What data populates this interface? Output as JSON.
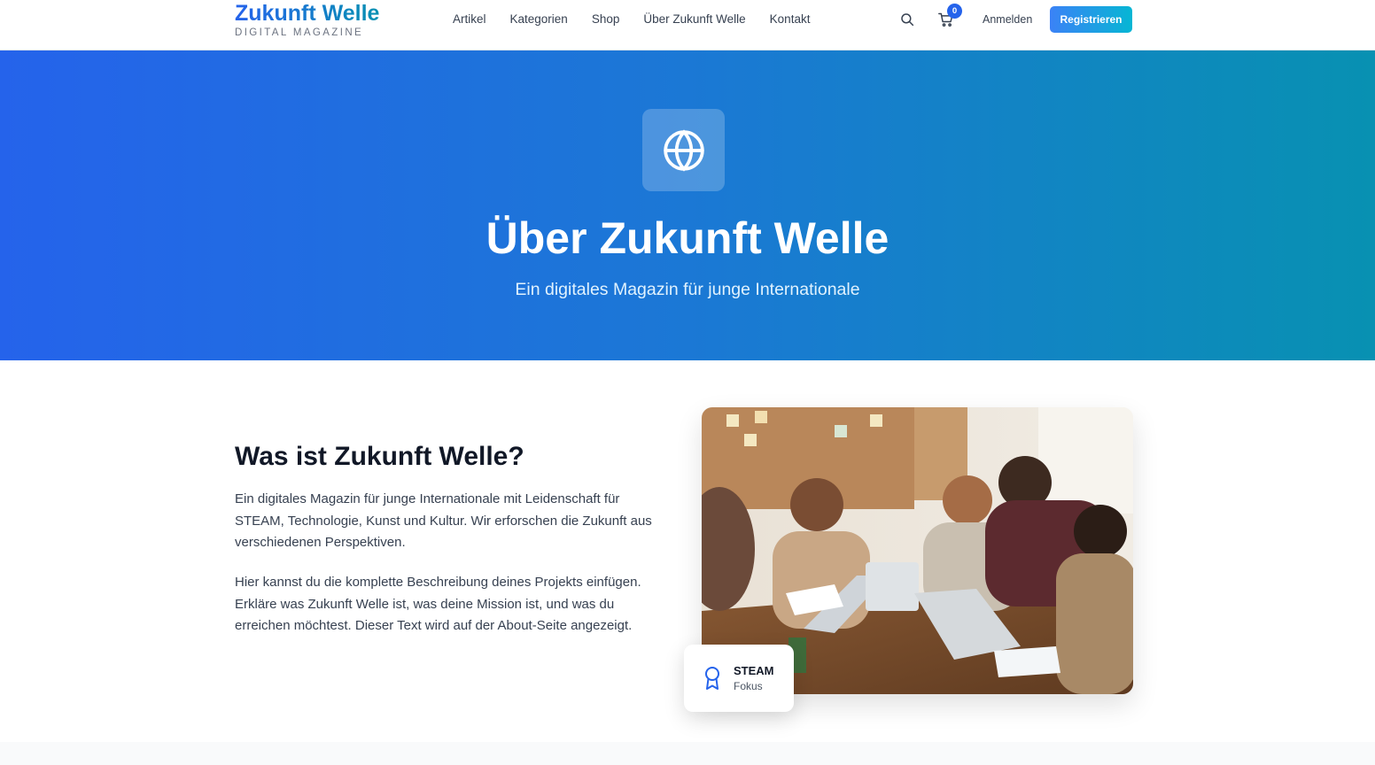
{
  "header": {
    "brand_title": "Zukunft Welle",
    "brand_subtitle": "DIGITAL MAGAZINE",
    "nav": [
      "Artikel",
      "Kategorien",
      "Shop",
      "Über Zukunft Welle",
      "Kontakt"
    ],
    "cart_count": "0",
    "login_label": "Anmelden",
    "register_label": "Registrieren"
  },
  "hero": {
    "title": "Über Zukunft Welle",
    "subtitle": "Ein digitales Magazin für junge Internationale",
    "icon": "globe-icon"
  },
  "about": {
    "title": "Was ist Zukunft Welle?",
    "paragraph1": "Ein digitales Magazin für junge Internationale mit Leidenschaft für STEAM, Technologie, Kunst und Kultur. Wir erforschen die Zukunft aus verschiedenen Perspektiven.",
    "paragraph2": "Hier kannst du die komplette Beschreibung deines Projekts einfügen. Erkläre was Zukunft Welle ist, was deine Mission ist, und was du erreichen möchtest. Dieser Text wird auf der About-Seite angezeigt."
  },
  "badge": {
    "title": "STEAM",
    "subtitle": "Fokus",
    "icon": "award-icon"
  },
  "colors": {
    "accent": "#2563eb",
    "accent_alt": "#0891b2"
  }
}
